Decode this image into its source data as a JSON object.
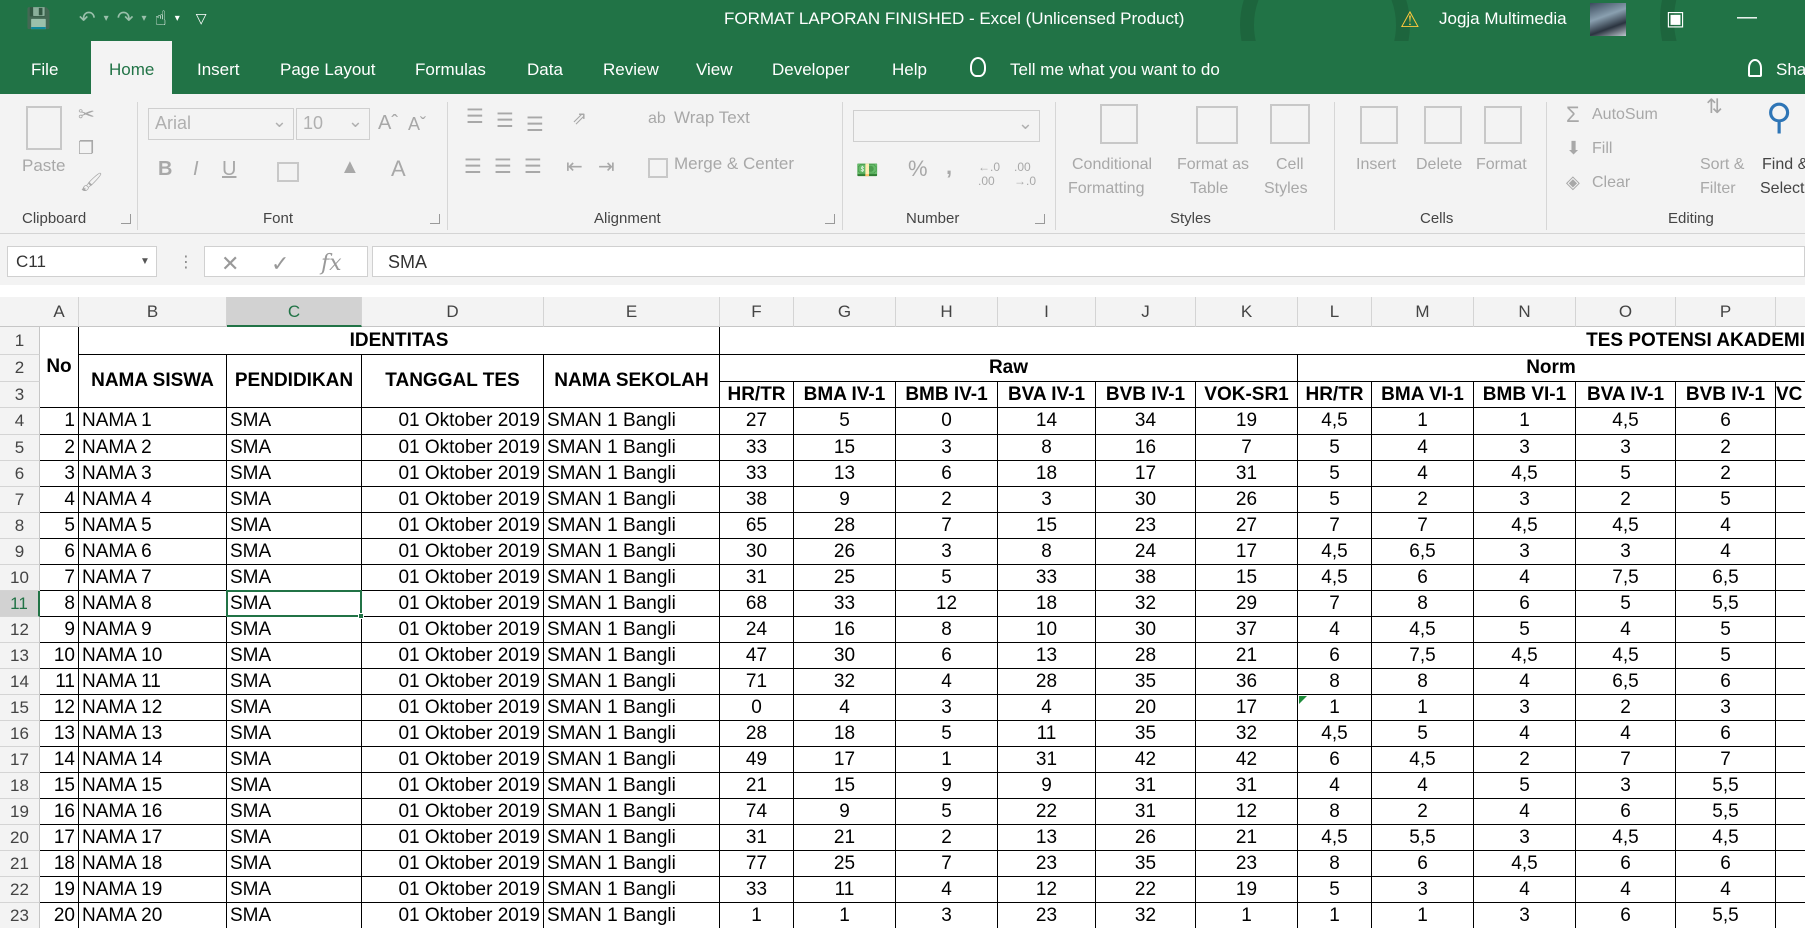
{
  "window": {
    "title": "FORMAT LAPORAN FINISHED  -  Excel (Unlicensed Product)",
    "user": "Jogja Multimedia"
  },
  "tabs": [
    "File",
    "Home",
    "Insert",
    "Page Layout",
    "Formulas",
    "Data",
    "Review",
    "View",
    "Developer",
    "Help"
  ],
  "tell_me": "Tell me what you want to do",
  "share": "Sha",
  "ribbon": {
    "clipboard": {
      "label": "Clipboard",
      "paste": "Paste"
    },
    "font": {
      "label": "Font",
      "name": "Arial",
      "size": "10",
      "bold": "B",
      "italic": "I",
      "underline": "U"
    },
    "alignment": {
      "label": "Alignment",
      "wrap": "Wrap Text",
      "merge": "Merge & Center"
    },
    "number": {
      "label": "Number",
      "percent": "%",
      "comma": ","
    },
    "styles": {
      "label": "Styles",
      "cond1": "Conditional",
      "cond2": "Formatting",
      "fmt1": "Format as",
      "fmt2": "Table",
      "cell1": "Cell",
      "cell2": "Styles"
    },
    "cells": {
      "label": "Cells",
      "insert": "Insert",
      "delete": "Delete",
      "format": "Format"
    },
    "editing": {
      "label": "Editing",
      "autosum": "AutoSum",
      "fill": "Fill",
      "clear": "Clear",
      "sort1": "Sort &",
      "sort2": "Filter",
      "find1": "Find &",
      "find2": "Select"
    }
  },
  "formula_bar": {
    "name_box": "C11",
    "fx": "fx",
    "value": "SMA"
  },
  "columns": [
    "A",
    "B",
    "C",
    "D",
    "E",
    "F",
    "G",
    "H",
    "I",
    "J",
    "K",
    "L",
    "M",
    "N",
    "O",
    "P"
  ],
  "selected_col": "C",
  "selected_row": "11",
  "row_numbers": [
    "1",
    "2",
    "3",
    "4",
    "5",
    "6",
    "7",
    "8",
    "9",
    "10",
    "11",
    "12",
    "13",
    "14",
    "15",
    "16",
    "17",
    "18",
    "19",
    "20",
    "21",
    "22",
    "23"
  ],
  "headers": {
    "no": "No",
    "identitas": "IDENTITAS",
    "nama_siswa": "NAMA SISWA",
    "pendidikan": "PENDIDIKAN",
    "tanggal_tes": "TANGGAL TES",
    "nama_sekolah": "NAMA SEKOLAH",
    "tpa": "TES POTENSI AKADEMI",
    "raw": "Raw",
    "norm": "Norm",
    "raw_cols": [
      "HR/TR",
      "BMA IV-1",
      "BMB IV-1",
      "BVA IV-1",
      "BVB IV-1",
      "VOK-SR1"
    ],
    "norm_cols": [
      "HR/TR",
      "BMA VI-1",
      "BMB VI-1",
      "BVA IV-1",
      "BVB IV-1",
      "VC"
    ]
  },
  "rows": [
    {
      "no": "1",
      "nama": "NAMA 1",
      "pend": "SMA",
      "tgl": "01 Oktober 2019",
      "sekolah": "SMAN 1 Bangli",
      "raw": [
        "27",
        "5",
        "0",
        "14",
        "34",
        "19"
      ],
      "norm": [
        "4,5",
        "1",
        "1",
        "4,5",
        "6"
      ]
    },
    {
      "no": "2",
      "nama": "NAMA 2",
      "pend": "SMA",
      "tgl": "01 Oktober 2019",
      "sekolah": "SMAN 1 Bangli",
      "raw": [
        "33",
        "15",
        "3",
        "8",
        "16",
        "7"
      ],
      "norm": [
        "5",
        "4",
        "3",
        "3",
        "2"
      ]
    },
    {
      "no": "3",
      "nama": "NAMA 3",
      "pend": "SMA",
      "tgl": "01 Oktober 2019",
      "sekolah": "SMAN 1 Bangli",
      "raw": [
        "33",
        "13",
        "6",
        "18",
        "17",
        "31"
      ],
      "norm": [
        "5",
        "4",
        "4,5",
        "5",
        "2"
      ]
    },
    {
      "no": "4",
      "nama": "NAMA 4",
      "pend": "SMA",
      "tgl": "01 Oktober 2019",
      "sekolah": "SMAN 1 Bangli",
      "raw": [
        "38",
        "9",
        "2",
        "3",
        "30",
        "26"
      ],
      "norm": [
        "5",
        "2",
        "3",
        "2",
        "5"
      ]
    },
    {
      "no": "5",
      "nama": "NAMA 5",
      "pend": "SMA",
      "tgl": "01 Oktober 2019",
      "sekolah": "SMAN 1 Bangli",
      "raw": [
        "65",
        "28",
        "7",
        "15",
        "23",
        "27"
      ],
      "norm": [
        "7",
        "7",
        "4,5",
        "4,5",
        "4"
      ]
    },
    {
      "no": "6",
      "nama": "NAMA 6",
      "pend": "SMA",
      "tgl": "01 Oktober 2019",
      "sekolah": "SMAN 1 Bangli",
      "raw": [
        "30",
        "26",
        "3",
        "8",
        "24",
        "17"
      ],
      "norm": [
        "4,5",
        "6,5",
        "3",
        "3",
        "4"
      ]
    },
    {
      "no": "7",
      "nama": "NAMA 7",
      "pend": "SMA",
      "tgl": "01 Oktober 2019",
      "sekolah": "SMAN 1 Bangli",
      "raw": [
        "31",
        "25",
        "5",
        "33",
        "38",
        "15"
      ],
      "norm": [
        "4,5",
        "6",
        "4",
        "7,5",
        "6,5"
      ]
    },
    {
      "no": "8",
      "nama": "NAMA 8",
      "pend": "SMA",
      "tgl": "01 Oktober 2019",
      "sekolah": "SMAN 1 Bangli",
      "raw": [
        "68",
        "33",
        "12",
        "18",
        "32",
        "29"
      ],
      "norm": [
        "7",
        "8",
        "6",
        "5",
        "5,5"
      ]
    },
    {
      "no": "9",
      "nama": "NAMA 9",
      "pend": "SMA",
      "tgl": "01 Oktober 2019",
      "sekolah": "SMAN 1 Bangli",
      "raw": [
        "24",
        "16",
        "8",
        "10",
        "30",
        "37"
      ],
      "norm": [
        "4",
        "4,5",
        "5",
        "4",
        "5"
      ]
    },
    {
      "no": "10",
      "nama": "NAMA 10",
      "pend": "SMA",
      "tgl": "01 Oktober 2019",
      "sekolah": "SMAN 1 Bangli",
      "raw": [
        "47",
        "30",
        "6",
        "13",
        "28",
        "21"
      ],
      "norm": [
        "6",
        "7,5",
        "4,5",
        "4,5",
        "5"
      ]
    },
    {
      "no": "11",
      "nama": "NAMA 11",
      "pend": "SMA",
      "tgl": "01 Oktober 2019",
      "sekolah": "SMAN 1 Bangli",
      "raw": [
        "71",
        "32",
        "4",
        "28",
        "35",
        "36"
      ],
      "norm": [
        "8",
        "8",
        "4",
        "6,5",
        "6"
      ]
    },
    {
      "no": "12",
      "nama": "NAMA 12",
      "pend": "SMA",
      "tgl": "01 Oktober 2019",
      "sekolah": "SMAN 1 Bangli",
      "raw": [
        "0",
        "4",
        "3",
        "4",
        "20",
        "17"
      ],
      "norm": [
        "1",
        "1",
        "3",
        "2",
        "3"
      ]
    },
    {
      "no": "13",
      "nama": "NAMA 13",
      "pend": "SMA",
      "tgl": "01 Oktober 2019",
      "sekolah": "SMAN 1 Bangli",
      "raw": [
        "28",
        "18",
        "5",
        "11",
        "35",
        "32"
      ],
      "norm": [
        "4,5",
        "5",
        "4",
        "4",
        "6"
      ]
    },
    {
      "no": "14",
      "nama": "NAMA 14",
      "pend": "SMA",
      "tgl": "01 Oktober 2019",
      "sekolah": "SMAN 1 Bangli",
      "raw": [
        "49",
        "17",
        "1",
        "31",
        "42",
        "42"
      ],
      "norm": [
        "6",
        "4,5",
        "2",
        "7",
        "7"
      ]
    },
    {
      "no": "15",
      "nama": "NAMA 15",
      "pend": "SMA",
      "tgl": "01 Oktober 2019",
      "sekolah": "SMAN 1 Bangli",
      "raw": [
        "21",
        "15",
        "9",
        "9",
        "31",
        "31"
      ],
      "norm": [
        "4",
        "4",
        "5",
        "3",
        "5,5"
      ]
    },
    {
      "no": "16",
      "nama": "NAMA 16",
      "pend": "SMA",
      "tgl": "01 Oktober 2019",
      "sekolah": "SMAN 1 Bangli",
      "raw": [
        "74",
        "9",
        "5",
        "22",
        "31",
        "12"
      ],
      "norm": [
        "8",
        "2",
        "4",
        "6",
        "5,5"
      ]
    },
    {
      "no": "17",
      "nama": "NAMA 17",
      "pend": "SMA",
      "tgl": "01 Oktober 2019",
      "sekolah": "SMAN 1 Bangli",
      "raw": [
        "31",
        "21",
        "2",
        "13",
        "26",
        "21"
      ],
      "norm": [
        "4,5",
        "5,5",
        "3",
        "4,5",
        "4,5"
      ]
    },
    {
      "no": "18",
      "nama": "NAMA 18",
      "pend": "SMA",
      "tgl": "01 Oktober 2019",
      "sekolah": "SMAN 1 Bangli",
      "raw": [
        "77",
        "25",
        "7",
        "23",
        "35",
        "23"
      ],
      "norm": [
        "8",
        "6",
        "4,5",
        "6",
        "6"
      ]
    },
    {
      "no": "19",
      "nama": "NAMA 19",
      "pend": "SMA",
      "tgl": "01 Oktober 2019",
      "sekolah": "SMAN 1 Bangli",
      "raw": [
        "33",
        "11",
        "4",
        "12",
        "22",
        "19"
      ],
      "norm": [
        "5",
        "3",
        "4",
        "4",
        "4"
      ]
    },
    {
      "no": "20",
      "nama": "NAMA 20",
      "pend": "SMA",
      "tgl": "01 Oktober 2019",
      "sekolah": "SMAN 1 Bangli",
      "raw": [
        "1",
        "1",
        "3",
        "23",
        "32",
        "1"
      ],
      "norm": [
        "1",
        "1",
        "3",
        "6",
        "5,5"
      ]
    }
  ]
}
